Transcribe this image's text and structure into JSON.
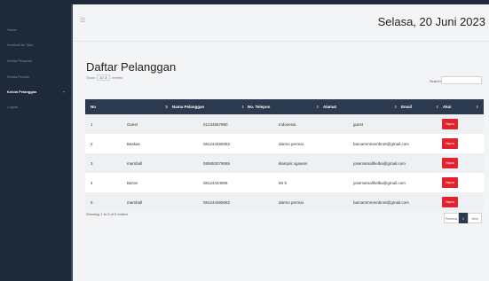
{
  "sidebar": {
    "items": [
      {
        "label": "Home"
      },
      {
        "label": "Kembali ke Toko"
      },
      {
        "label": "Kelola Pesanan"
      },
      {
        "label": "Kelola Produk"
      },
      {
        "label": "Kelola Pelanggan"
      },
      {
        "label": "Logout"
      }
    ]
  },
  "header": {
    "date": "Selasa, 20 Juni 2023"
  },
  "main": {
    "title": "Daftar Pelanggan",
    "show_prefix": "Show",
    "show_value": "10",
    "show_suffix": "entries",
    "search_label": "Search:",
    "columns": [
      "No",
      "Nama Pelanggan",
      "No. Telepon",
      "Alamat",
      "Email",
      "Aksi"
    ],
    "rows": [
      {
        "no": "1",
        "nama": "Guest",
        "telp": "01234567890",
        "alamat": "Indonesia",
        "email": "guest"
      },
      {
        "no": "2",
        "nama": "Baskas",
        "telp": "081244465062",
        "alamat": "darmo permai",
        "email": "barcammmembro6@gmail.com"
      },
      {
        "no": "3",
        "nama": "marshall",
        "telp": "085853079065",
        "alamat": "klampis ngasem",
        "email": "josemarsallhelba@gmail.com"
      },
      {
        "no": "4",
        "nama": "Baroe",
        "telp": "08124444906",
        "alamat": "Mr b",
        "email": "josemarsallhelba@gmail.com"
      },
      {
        "no": "5",
        "nama": "marshall",
        "telp": "081244465062",
        "alamat": "darmo permai",
        "email": "barcammmembro6@gmail.com"
      }
    ],
    "action_label": "Hapus",
    "info": "Showing 1 to 5 of 5 entries",
    "pagination": {
      "previous": "Previous",
      "current": "1",
      "next": "Next"
    }
  }
}
